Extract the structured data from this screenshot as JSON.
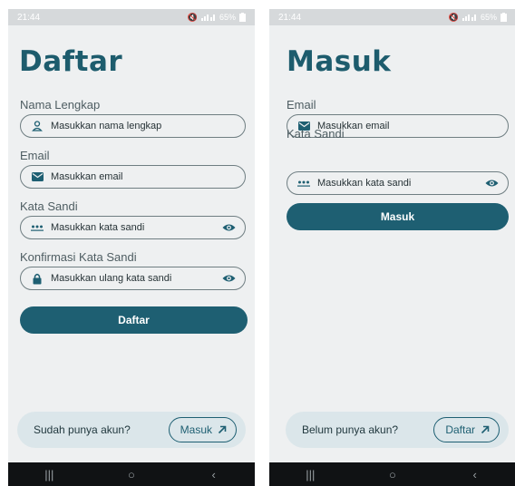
{
  "colors": {
    "accent": "#1e5f72",
    "title": "#1d5c6d",
    "card": "#dbe6ea",
    "background": "#eef0f1"
  },
  "register": {
    "status": {
      "time": "21:44",
      "battery": "65%"
    },
    "title": "Daftar",
    "name": {
      "label": "Nama Lengkap",
      "placeholder": "Masukkan nama lengkap",
      "icon": "person-icon"
    },
    "email": {
      "label": "Email",
      "placeholder": "Masukkan email",
      "icon": "mail-icon"
    },
    "password": {
      "label": "Kata Sandi",
      "placeholder": "Masukkan kata sandi",
      "icon": "password-dots-icon"
    },
    "confirm": {
      "label": "Konfirmasi Kata Sandi",
      "placeholder": "Masukkan ulang kata sandi",
      "icon": "lock-icon"
    },
    "submit_label": "Daftar",
    "footer": {
      "prompt": "Sudah punya akun?",
      "button_label": "Masuk"
    }
  },
  "login": {
    "status": {
      "time": "21:44",
      "battery": "65%"
    },
    "title": "Masuk",
    "email": {
      "label": "Email",
      "placeholder": "Masukkan email",
      "icon": "mail-icon"
    },
    "password": {
      "label": "Kata Sandi",
      "placeholder": "Masukkan kata sandi",
      "icon": "password-dots-icon"
    },
    "submit_label": "Masuk",
    "footer": {
      "prompt": "Belum punya akun?",
      "button_label": "Daftar"
    }
  },
  "navbar": {
    "recents": "|||",
    "home": "○",
    "back": "‹"
  }
}
